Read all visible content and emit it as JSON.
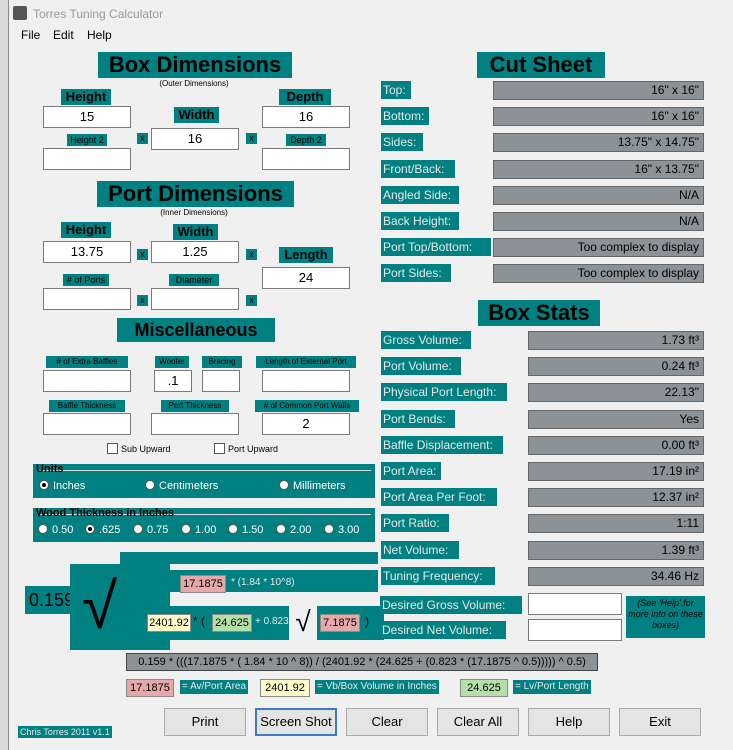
{
  "window": {
    "title": "Torres Tuning Calculator"
  },
  "menu": [
    "File",
    "Edit",
    "Help"
  ],
  "box_dimensions": {
    "title": "Box Dimensions",
    "subtitle": "(Outer Dimensions)",
    "height_label": "Height",
    "height_value": "15",
    "width_label": "Width",
    "width_value": "16",
    "depth_label": "Depth",
    "depth_value": "16",
    "height2_label": "Height 2",
    "height2_value": "",
    "depth2_label": "Depth 2",
    "depth2_value": ""
  },
  "port_dimensions": {
    "title": "Port Dimensions",
    "subtitle": "(Inner Dimensions)",
    "height_label": "Height",
    "height_value": "13.75",
    "width_label": "Width",
    "width_value": "1.25",
    "length_label": "Length",
    "length_value": "24",
    "ports_label": "# of Ports",
    "ports_value": "",
    "diameter_label": "Diameter",
    "diameter_value": ""
  },
  "misc": {
    "title": "Miscellaneous",
    "extra_baffles_label": "# of Extra Baffles",
    "extra_baffles_value": "",
    "woofer_label": "Woofer",
    "woofer_value": ".1",
    "bracing_label": "Bracing",
    "bracing_value": "",
    "ext_port_label": "Length of External Port",
    "ext_port_value": "",
    "baffle_thickness_label": "Baffle Thickness",
    "baffle_thickness_value": "",
    "port_thickness_label": "Port Thickness",
    "port_thickness_value": "",
    "common_walls_label": "# of Common Port Walls",
    "common_walls_value": "2",
    "sub_upward_label": "Sub Upward",
    "port_upward_label": "Port Upward"
  },
  "units": {
    "title": "Units",
    "options": [
      "Inches",
      "Centimeters",
      "Millimeters"
    ],
    "selected": "Inches"
  },
  "wood": {
    "title": "Wood Thickness in Inches",
    "options": [
      "0.50",
      ".625",
      "0.75",
      "1.00",
      "1.50",
      "2.00",
      "3.00"
    ],
    "selected": ".625"
  },
  "cut_sheet": {
    "title": "Cut Sheet",
    "rows": [
      {
        "label": "Top:",
        "value": "16\" x 16\""
      },
      {
        "label": "Bottom:",
        "value": "16\" x 16\""
      },
      {
        "label": "Sides:",
        "value": "13.75\" x 14.75\""
      },
      {
        "label": "Front/Back:",
        "value": "16\" x 13.75\""
      },
      {
        "label": "Angled Side:",
        "value": "N/A"
      },
      {
        "label": "Back Height:",
        "value": "N/A"
      },
      {
        "label": "Port Top/Bottom:",
        "value": "Too complex to display"
      },
      {
        "label": "Port Sides:",
        "value": "Too complex to display"
      }
    ]
  },
  "box_stats": {
    "title": "Box Stats",
    "rows": [
      {
        "label": "Gross Volume:",
        "value": "1.73 ft³"
      },
      {
        "label": "Port Volume:",
        "value": "0.24 ft³"
      },
      {
        "label": "Physical Port Length:",
        "value": "22.13\""
      },
      {
        "label": "Port Bends:",
        "value": "Yes"
      },
      {
        "label": "Baffle Displacement:",
        "value": "0.00 ft³"
      },
      {
        "label": "Port Area:",
        "value": "17.19 in²"
      },
      {
        "label": "Port Area Per Foot:",
        "value": "12.37 in²"
      },
      {
        "label": "Port Ratio:",
        "value": "1:11"
      },
      {
        "label": "Net Volume:",
        "value": "1.39 ft³"
      },
      {
        "label": "Tuning Frequency:",
        "value": "34.46 Hz"
      }
    ],
    "desired_gross_label": "Desired Gross Volume:",
    "desired_gross_value": "",
    "desired_net_label": "Desired Net Volume:",
    "desired_net_value": "",
    "help_note": "(See 'Help' for more info on these boxes)"
  },
  "formula": {
    "coef": "0.159",
    "av": "17.1875",
    "mult_text": "* (1.84 * 10^8)",
    "vb": "2401.92",
    "paren_open": "* (",
    "lv": "24.625",
    "plus_text": "+ 0.823",
    "av2": "7.1875",
    "paren_close": ")",
    "full": "0.159 * (((17.1875 * ( 1.84 * 10 ^ 8)) / (2401.92 * (24.625 + (0.823 * (17.1875 ^ 0.5))))) ^ 0.5)",
    "legend": [
      {
        "value": "17.1875",
        "caption": "= Av/Port Area",
        "color": "#e6a8a8"
      },
      {
        "value": "2401.92",
        "caption": "= Vb/Box Volume in Inches",
        "color": "#fffbc8"
      },
      {
        "value": "24.625",
        "caption": "= Lv/Port Length",
        "color": "#b4e0a8"
      }
    ],
    "radical": "√"
  },
  "credit": "Chris Torres 2011 v1.1",
  "x_symbol": "x",
  "buttons": [
    "Print",
    "Screen Shot",
    "Clear",
    "Clear All",
    "Help",
    "Exit"
  ],
  "colors": {
    "teal": "#008080",
    "output_gray": "#8d9296",
    "background": "#f0f0f0"
  }
}
